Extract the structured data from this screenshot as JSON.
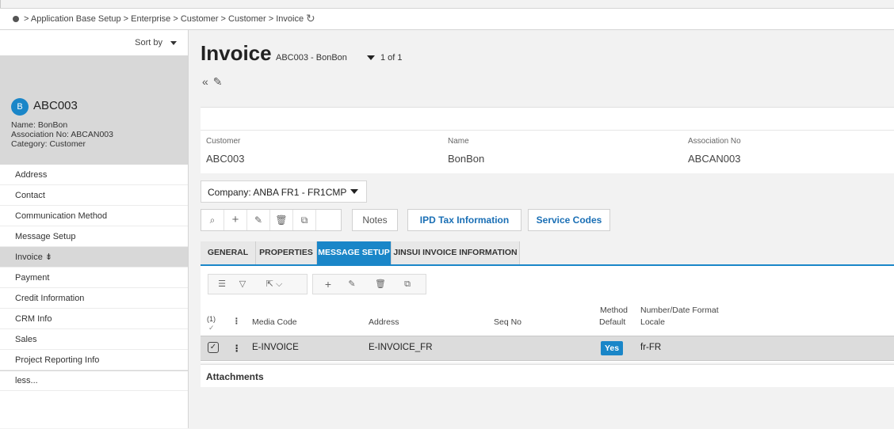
{
  "breadcrumb": {
    "path": "> Application Base Setup > Enterprise > Customer > Customer > Invoice"
  },
  "navigator": {
    "sort_label": "Sort by",
    "record": {
      "avatar_letter": "B",
      "id": "ABC003",
      "name_line": "Name:  BonBon",
      "association_line": "Association No:  ABCAN003",
      "category_line": "Category:  Customer"
    },
    "items": [
      {
        "label": "Address"
      },
      {
        "label": "Contact"
      },
      {
        "label": "Communication Method"
      },
      {
        "label": "Message Setup"
      },
      {
        "label": "Invoice ⇟"
      },
      {
        "label": "Payment"
      },
      {
        "label": "Credit Information"
      },
      {
        "label": "CRM Info"
      },
      {
        "label": "Sales"
      },
      {
        "label": "Project Reporting Info"
      },
      {
        "label": "less..."
      }
    ]
  },
  "page": {
    "title": "Invoice",
    "record_key": "ABC003 - BonBon",
    "count": "1 of 1"
  },
  "header_fields": [
    {
      "label": "Customer",
      "value": "ABC003"
    },
    {
      "label": "Name",
      "value": "BonBon"
    },
    {
      "label": "Association No",
      "value": "ABCAN003"
    }
  ],
  "company_selector": "Company: ANBA FR1 - FR1CMP",
  "toolbar": {
    "notes": "Notes",
    "ipd_tax": "IPD Tax Information",
    "service_codes": "Service Codes"
  },
  "tabs": [
    {
      "label": "GENERAL"
    },
    {
      "label": "PROPERTIES"
    },
    {
      "label": "MESSAGE SETUP"
    },
    {
      "label": "JINSUI INVOICE INFORMATION"
    }
  ],
  "grid": {
    "count_label": "(1)",
    "columns": {
      "media_code": "Media Code",
      "address": "Address",
      "seq_no": "Seq No",
      "method_default_1": "Method",
      "method_default_2": "Default",
      "format_1": "Number/Date Format",
      "format_2": "Locale"
    },
    "rows": [
      {
        "media_code": "E-INVOICE",
        "address": "E-INVOICE_FR",
        "seq_no": "",
        "method_default": "Yes",
        "locale": "fr-FR"
      }
    ]
  },
  "attachments_label": "Attachments",
  "colors": {
    "accent": "#1a86c8",
    "selected_row": "#dcdcdc"
  }
}
